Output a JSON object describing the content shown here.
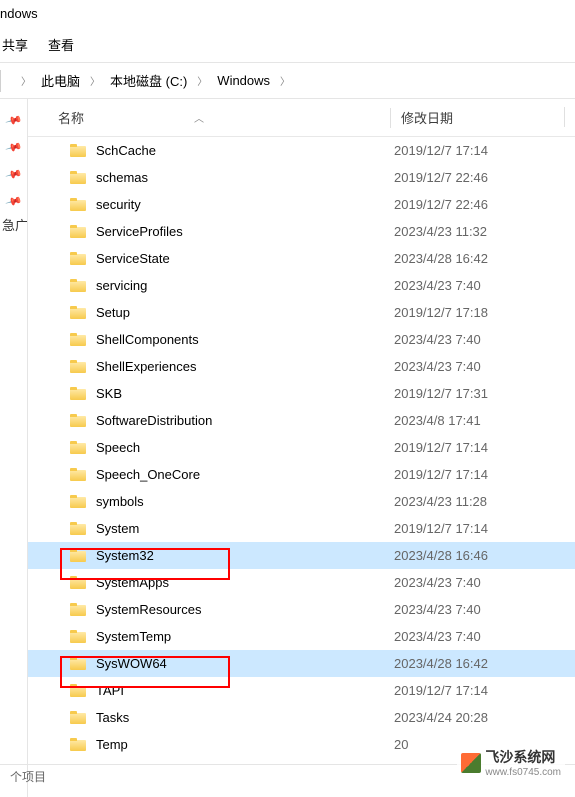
{
  "window": {
    "title": "ndows"
  },
  "ribbon": {
    "share": "共享",
    "view": "查看"
  },
  "breadcrumb": {
    "pc": "此电脑",
    "drive": "本地磁盘 (C:)",
    "folder": "Windows"
  },
  "sidebar": {
    "quick_access_partial": "急广"
  },
  "headers": {
    "name": "名称",
    "date": "修改日期"
  },
  "files": [
    {
      "name": "SchCache",
      "date": "2019/12/7 17:14"
    },
    {
      "name": "schemas",
      "date": "2019/12/7 22:46"
    },
    {
      "name": "security",
      "date": "2019/12/7 22:46"
    },
    {
      "name": "ServiceProfiles",
      "date": "2023/4/23 11:32"
    },
    {
      "name": "ServiceState",
      "date": "2023/4/28 16:42"
    },
    {
      "name": "servicing",
      "date": "2023/4/23 7:40"
    },
    {
      "name": "Setup",
      "date": "2019/12/7 17:18"
    },
    {
      "name": "ShellComponents",
      "date": "2023/4/23 7:40"
    },
    {
      "name": "ShellExperiences",
      "date": "2023/4/23 7:40"
    },
    {
      "name": "SKB",
      "date": "2019/12/7 17:31"
    },
    {
      "name": "SoftwareDistribution",
      "date": "2023/4/8 17:41"
    },
    {
      "name": "Speech",
      "date": "2019/12/7 17:14"
    },
    {
      "name": "Speech_OneCore",
      "date": "2019/12/7 17:14"
    },
    {
      "name": "symbols",
      "date": "2023/4/23 11:28"
    },
    {
      "name": "System",
      "date": "2019/12/7 17:14"
    },
    {
      "name": "System32",
      "date": "2023/4/28 16:46",
      "selected": true
    },
    {
      "name": "SystemApps",
      "date": "2023/4/23 7:40"
    },
    {
      "name": "SystemResources",
      "date": "2023/4/23 7:40"
    },
    {
      "name": "SystemTemp",
      "date": "2023/4/23 7:40"
    },
    {
      "name": "SysWOW64",
      "date": "2023/4/28 16:42",
      "selected": true
    },
    {
      "name": "TAPI",
      "date": "2019/12/7 17:14"
    },
    {
      "name": "Tasks",
      "date": "2023/4/24 20:28"
    },
    {
      "name": "Temp",
      "date": "20"
    }
  ],
  "footer": {
    "items_partial": "个项目"
  },
  "watermark": {
    "text": "飞沙系统网",
    "url": "www.fs0745.com"
  }
}
